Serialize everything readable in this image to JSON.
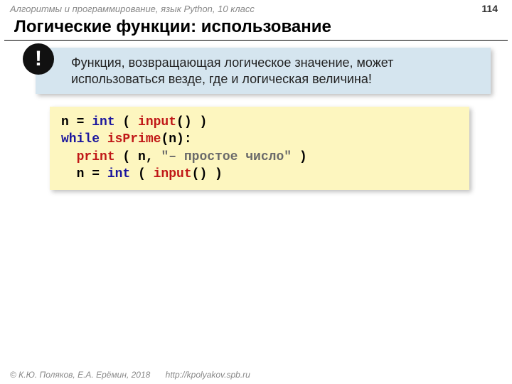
{
  "header": {
    "course": "Алгоритмы и программирование, язык Python, 10 класс",
    "page": "114"
  },
  "title": "Логические функции: использование",
  "note": {
    "badge": "!",
    "text": "Функция, возвращающая логическое значение, может использоваться везде, где и логическая величина!"
  },
  "code": {
    "l1_a": "n = ",
    "l1_b": "int",
    "l1_c": " ( ",
    "l1_d": "input",
    "l1_e": "() )",
    "l2_a": "while",
    "l2_b": " ",
    "l2_c": "isPrime",
    "l2_d": "(n):",
    "l3_a": "  ",
    "l3_b": "print",
    "l3_c": " ( n, ",
    "l3_d": "\"– простое число\"",
    "l3_e": " )",
    "l4_a": "  n = ",
    "l4_b": "int",
    "l4_c": " ( ",
    "l4_d": "input",
    "l4_e": "() )"
  },
  "footer": {
    "copyright": "© К.Ю. Поляков, Е.А. Ерёмин, 2018",
    "url": "http://kpolyakov.spb.ru"
  }
}
